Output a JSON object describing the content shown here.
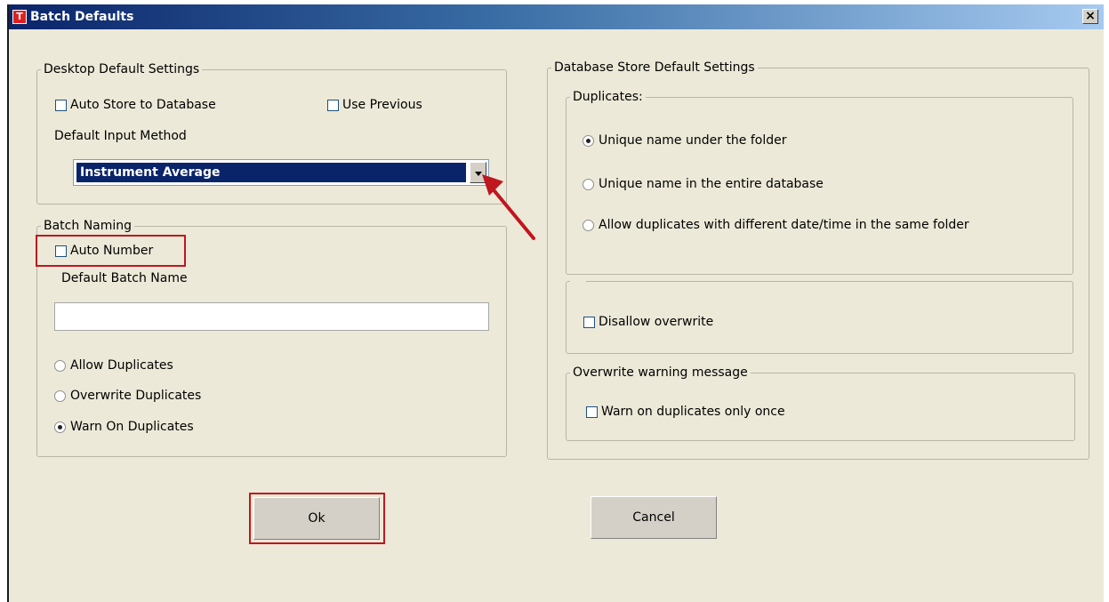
{
  "window": {
    "title": "Batch Defaults",
    "icon_glyph": "T",
    "close_glyph": "×"
  },
  "desktop": {
    "legend": "Desktop Default Settings",
    "auto_store": {
      "label": "Auto Store to Database",
      "checked": false
    },
    "use_previous": {
      "label": "Use Previous",
      "checked": false
    },
    "input_method_label": "Default Input Method",
    "input_method_value": "Instrument Average"
  },
  "batch_naming": {
    "legend": "Batch Naming",
    "auto_number": {
      "label": "Auto Number",
      "checked": false
    },
    "default_name_label": "Default Batch Name",
    "default_name_value": "",
    "options": [
      {
        "label": "Allow Duplicates",
        "selected": false
      },
      {
        "label": "Overwrite Duplicates",
        "selected": false
      },
      {
        "label": "Warn On Duplicates",
        "selected": true
      }
    ]
  },
  "database": {
    "legend": "Database Store Default Settings",
    "duplicates": {
      "legend": "Duplicates:",
      "options": [
        {
          "label": "Unique name under the folder",
          "selected": true
        },
        {
          "label": "Unique name in the entire database",
          "selected": false
        },
        {
          "label": "Allow duplicates with different date/time in the same folder",
          "selected": false
        }
      ]
    },
    "disallow_overwrite": {
      "label": "Disallow overwrite",
      "checked": false
    },
    "warning": {
      "legend": "Overwrite warning message",
      "warn_once": {
        "label": "Warn on duplicates only once",
        "checked": false
      }
    }
  },
  "buttons": {
    "ok": "Ok",
    "cancel": "Cancel"
  },
  "annotation_color": "#c0161f"
}
